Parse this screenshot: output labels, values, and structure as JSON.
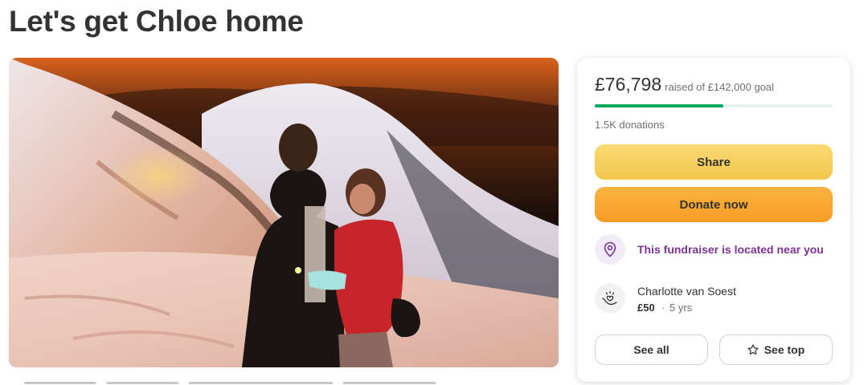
{
  "page": {
    "title": "Let's get Chloe home"
  },
  "hero": {
    "alt": "photo-couple-snowy-mountain-sunset"
  },
  "donation_card": {
    "amount_raised": "£76,798",
    "goal_text": "raised of £142,000 goal",
    "progress_fraction": 0.54,
    "donations_count": "1.5K donations",
    "share_label": "Share",
    "donate_label": "Donate now",
    "location_text": "This fundraiser is located near you",
    "recent_donor": {
      "name": "Charlotte van Soest",
      "amount": "£50",
      "separator": "·",
      "time": "5 yrs"
    },
    "see_all_label": "See all",
    "see_top_label": "See top"
  },
  "colors": {
    "progress_fill": "#02a95c",
    "progress_track": "#e3f4ec",
    "share_button": "#f4c64c",
    "donate_button": "#f69c25",
    "location_text": "#7a3496"
  },
  "icons": {
    "location": "map-pin-icon",
    "donor": "heart-hands-icon",
    "see_top": "star-icon"
  }
}
